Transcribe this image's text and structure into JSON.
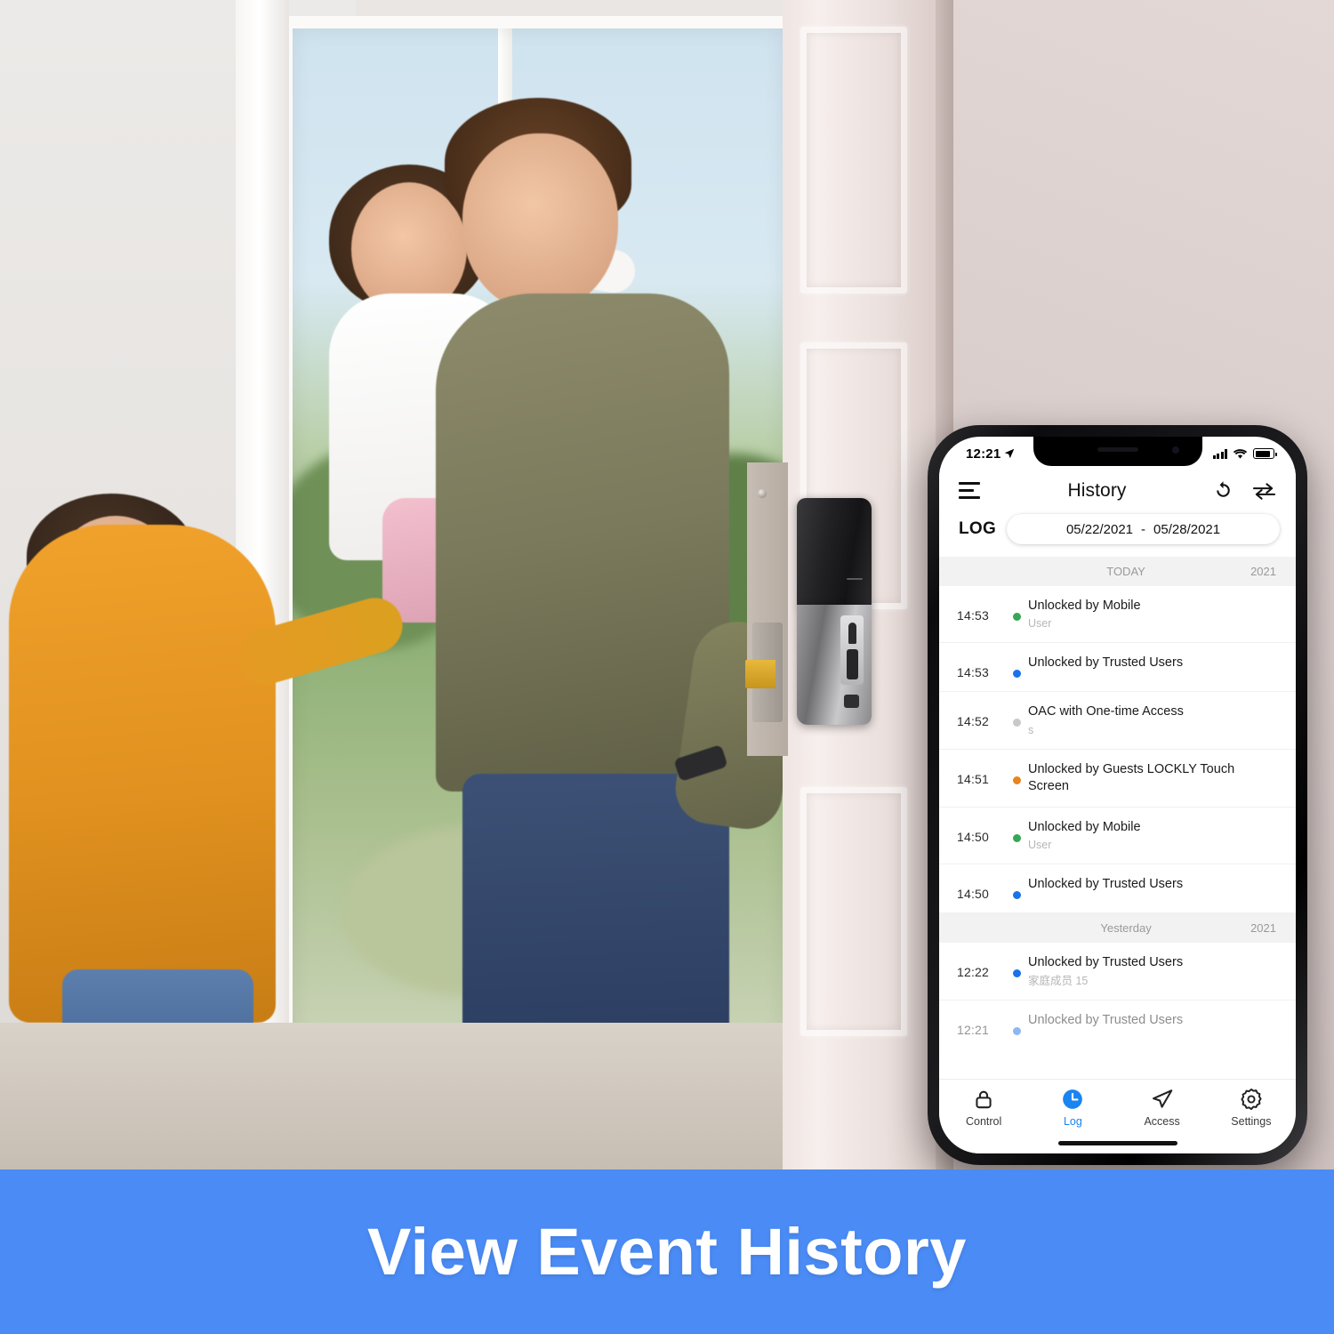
{
  "scene": {
    "description": "family-at-front-door-photo",
    "lock_device": "lockly-smart-deadbolt"
  },
  "phone": {
    "statusbar": {
      "time": "12:21",
      "location_icon": "location-arrow-icon",
      "signal_icon": "cellular-signal-icon",
      "wifi_icon": "wifi-icon",
      "battery_icon": "battery-icon"
    },
    "navbar": {
      "menu_icon": "hamburger-menu-icon",
      "title": "History",
      "refresh_icon": "refresh-icon",
      "swap_icon": "swap-arrows-icon"
    },
    "log_header": {
      "label": "LOG",
      "date_range_start": "05/22/2021",
      "date_range_separator": "-",
      "date_range_end": "05/28/2021"
    },
    "sections": [
      {
        "title": "TODAY",
        "year": "2021",
        "entries": [
          {
            "time": "14:53",
            "dot": "#34a853",
            "title": "Unlocked by Mobile",
            "subtitle": "User"
          },
          {
            "time": "14:53",
            "dot": "#1a73e8",
            "title": "Unlocked by Trusted Users",
            "subtitle": ""
          },
          {
            "time": "14:52",
            "dot": "#c8c8c8",
            "title": "OAC with One-time Access",
            "subtitle": "s"
          },
          {
            "time": "14:51",
            "dot": "#e8841a",
            "title": "Unlocked by Guests LOCKLY Touch Screen",
            "subtitle": ""
          },
          {
            "time": "14:50",
            "dot": "#34a853",
            "title": "Unlocked by Mobile",
            "subtitle": "User"
          },
          {
            "time": "14:50",
            "dot": "#1a73e8",
            "title": "Unlocked by Trusted Users",
            "subtitle": ""
          }
        ]
      },
      {
        "title": "Yesterday",
        "year": "2021",
        "entries": [
          {
            "time": "12:22",
            "dot": "#1a73e8",
            "title": "Unlocked by Trusted Users",
            "subtitle": "家庭成员 15"
          },
          {
            "time": "12:21",
            "dot": "#1a73e8",
            "title": "Unlocked by Trusted Users",
            "subtitle": ""
          }
        ]
      }
    ],
    "tabs": [
      {
        "label": "Control",
        "icon": "lock-icon",
        "active": false
      },
      {
        "label": "Log",
        "icon": "clock-icon",
        "active": true
      },
      {
        "label": "Access",
        "icon": "paper-plane-icon",
        "active": false
      },
      {
        "label": "Settings",
        "icon": "gear-icon",
        "active": false
      }
    ]
  },
  "banner": {
    "text": "View Event History",
    "background_color": "#4a8bf5",
    "text_color": "#ffffff"
  }
}
